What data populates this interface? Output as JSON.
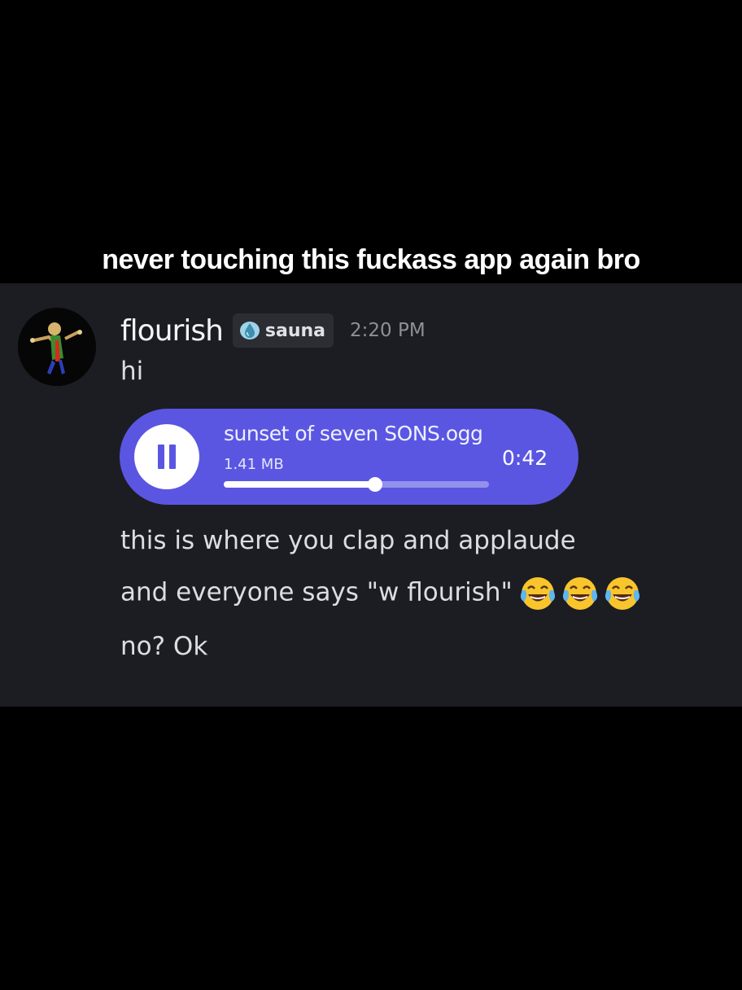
{
  "caption": "never touching this fuckass app again bro",
  "message": {
    "username": "flourish",
    "tag": "sauna",
    "timestamp": "2:20 PM",
    "lines": {
      "first": "hi",
      "second": "this is where you clap and applaude",
      "third": "and everyone says \"w flourish\"",
      "fourth": "no? Ok"
    },
    "emoji": [
      "face-with-tears-of-joy",
      "face-with-tears-of-joy",
      "face-with-tears-of-joy"
    ]
  },
  "attachment": {
    "file_name": "sunset of seven SONS.ogg",
    "file_size": "1.41 MB",
    "duration": "0:42",
    "progress": 0.57,
    "state": "playing"
  },
  "colors": {
    "panel": "#1c1d22",
    "audio_accent": "#5a56e2",
    "text": "#dbdee1"
  }
}
